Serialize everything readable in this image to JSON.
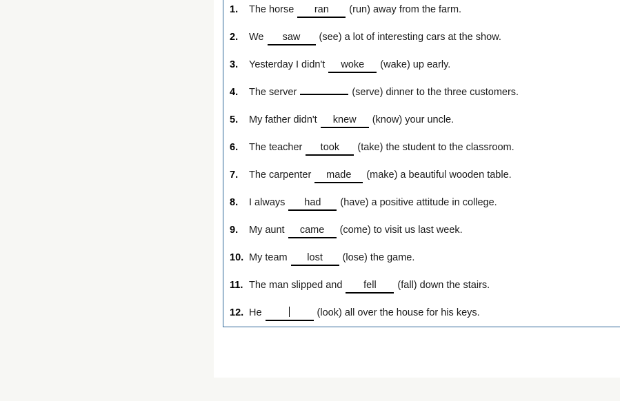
{
  "page": {
    "background_color": "#f7f7f4",
    "card_background_color": "#ffffff",
    "panel_border_color": "#2a6496",
    "text_color": "#1a1a1a",
    "blank_rule_color": "#000000"
  },
  "exercise": {
    "items": [
      {
        "number": "1.",
        "pre": "The horse",
        "answer": "ran",
        "post": "(run) away from the farm.",
        "focused": false
      },
      {
        "number": "2.",
        "pre": "We",
        "answer": "saw",
        "post": "(see) a lot of interesting cars at the show.",
        "focused": false
      },
      {
        "number": "3.",
        "pre": "Yesterday I didn't",
        "answer": "woke",
        "post": "(wake) up early.",
        "focused": false
      },
      {
        "number": "4.",
        "pre": "The server",
        "answer": "",
        "post": "(serve) dinner to the three customers.",
        "focused": false
      },
      {
        "number": "5.",
        "pre": "My father didn't",
        "answer": "knew",
        "post": "(know) your uncle.",
        "focused": false
      },
      {
        "number": "6.",
        "pre": "The teacher",
        "answer": "took",
        "post": "(take) the student to the classroom.",
        "focused": false
      },
      {
        "number": "7.",
        "pre": "The carpenter",
        "answer": "made",
        "post": "(make) a beautiful wooden table.",
        "focused": false
      },
      {
        "number": "8.",
        "pre": "I always",
        "answer": "had",
        "post": "(have) a positive attitude in college.",
        "focused": false
      },
      {
        "number": "9.",
        "pre": "My aunt",
        "answer": "came",
        "post": "(come) to visit us last week.",
        "focused": false
      },
      {
        "number": "10.",
        "pre": "My team",
        "answer": "lost",
        "post": "(lose) the game.",
        "focused": false
      },
      {
        "number": "11.",
        "pre": "The man slipped and",
        "answer": "fell",
        "post": "(fall) down the stairs.",
        "focused": false
      },
      {
        "number": "12.",
        "pre": "He",
        "answer": "",
        "post": "(look) all over the house for his keys.",
        "focused": true
      }
    ]
  }
}
